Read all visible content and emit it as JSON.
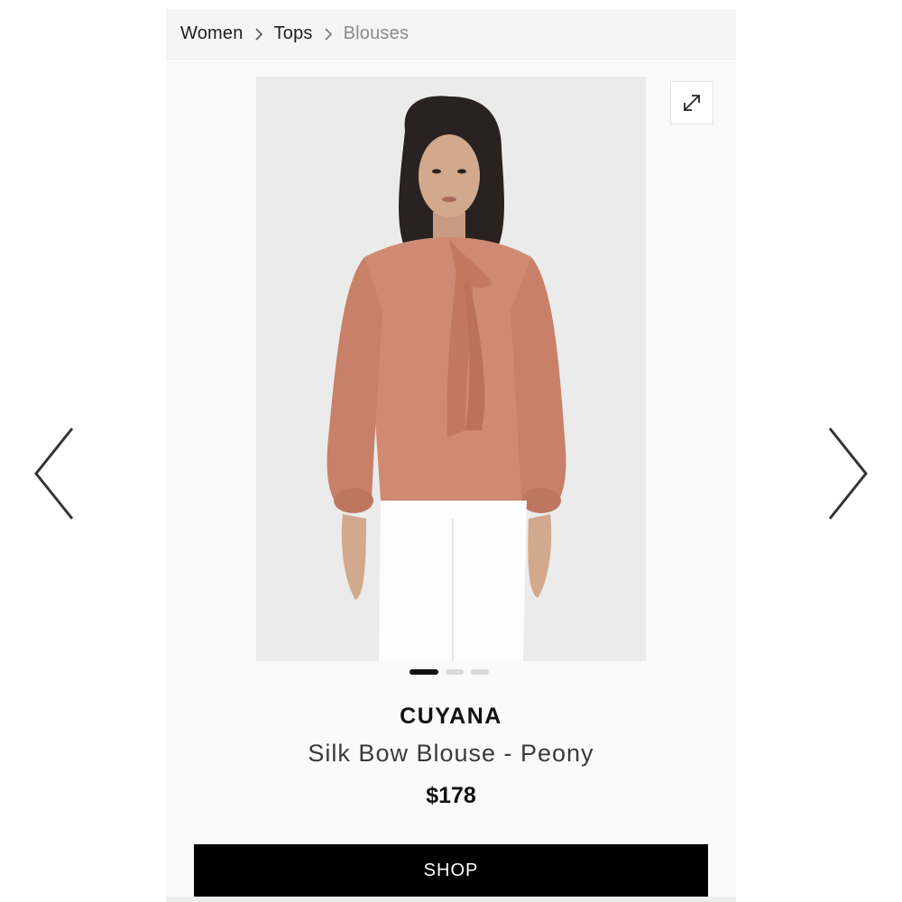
{
  "breadcrumb": {
    "items": [
      {
        "label": "Women"
      },
      {
        "label": "Tops"
      },
      {
        "label": "Blouses"
      }
    ]
  },
  "gallery": {
    "expand_icon": "expand-diagonal-icon",
    "prev_icon": "chevron-left-icon",
    "next_icon": "chevron-right-icon",
    "image_count": 3,
    "active_index": 0
  },
  "product": {
    "brand": "CUYANA",
    "name": "Silk Bow Blouse - Peony",
    "price": "$178",
    "blouse_color": "#d08a73",
    "pants_color": "#ffffff"
  },
  "actions": {
    "shop_label": "SHOP"
  }
}
